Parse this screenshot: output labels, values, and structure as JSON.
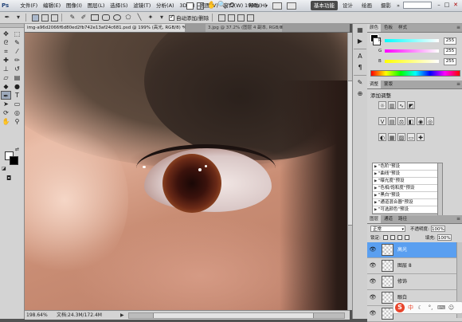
{
  "app": {
    "logo": "Ps"
  },
  "menu": [
    "文件(F)",
    "编辑(E)",
    "图像(I)",
    "图层(L)",
    "选择(S)",
    "滤镜(T)",
    "分析(A)",
    "3D(D)",
    "视图(V)",
    "窗口(W)",
    "帮助(H)"
  ],
  "menubar": {
    "zoom": "199%",
    "workspaces": [
      "基本功能",
      "设计",
      "绘画",
      "摄影"
    ],
    "more": "»"
  },
  "options": {
    "auto_add_label": "自动添加/删除"
  },
  "document": {
    "active_tab": "img-a96d2066f6d80ed2fb742e13af24c681.psd @ 199% (高光, RGB/8) *",
    "inactive_tab": "3.jpg @ 37.2% (图层 4 副本, RGB/8)",
    "close_glyph": "×"
  },
  "status": {
    "zoom": "198.64%",
    "doc_info": "文档:24.3M/172.4M",
    "arrow": "▶"
  },
  "color_panel": {
    "tabs": [
      "颜色",
      "色板",
      "样式"
    ],
    "rows": [
      {
        "label": "R",
        "value": "255",
        "gradient": "linear-gradient(90deg,#00ffff,#ffffff)"
      },
      {
        "label": "G",
        "value": "255",
        "gradient": "linear-gradient(90deg,#ff00ff,#ffffff)"
      },
      {
        "label": "B",
        "value": "255",
        "gradient": "linear-gradient(90deg,#ffff00,#ffffff)"
      }
    ]
  },
  "adjustments_panel": {
    "tabs": [
      "调整",
      "蒙版"
    ],
    "title": "添加调整",
    "presets": [
      "\"色阶\"预设",
      "\"曲线\"预设",
      "\"曝光度\"预设",
      "\"色相/饱和度\"预设",
      "\"黑白\"预设",
      "\"通道混合器\"预设",
      "\"可选颜色\"预设"
    ]
  },
  "layers_panel": {
    "tabs": [
      "图层",
      "通道",
      "路径"
    ],
    "blend_mode": "正常",
    "opacity_label": "不透明度:",
    "opacity": "100%",
    "lock_label": "锁定:",
    "fill_label": "填充:",
    "fill": "100%",
    "layers": [
      {
        "name": "高光",
        "selected": true
      },
      {
        "name": "图层 8",
        "selected": false
      },
      {
        "name": "修饰",
        "selected": false
      },
      {
        "name": "眼白",
        "selected": false
      },
      {
        "name": "",
        "selected": false
      }
    ]
  },
  "ime": {
    "logo": "S",
    "mode": "中"
  },
  "icons": {
    "eye": "eye-icon",
    "move": "move-tool-icon",
    "marquee": "marquee-tool-icon",
    "lasso": "lasso-tool-icon",
    "brush": "brush-tool-icon",
    "pen": "pen-tool-icon",
    "type": "type-tool-icon",
    "hand": "hand-tool-icon",
    "zoom": "zoom-tool-icon"
  },
  "colors": {
    "selected_layer": "#5a9ff0",
    "workspace_active": "#4a4a4a",
    "panel_bg": "#d4d4d4"
  }
}
